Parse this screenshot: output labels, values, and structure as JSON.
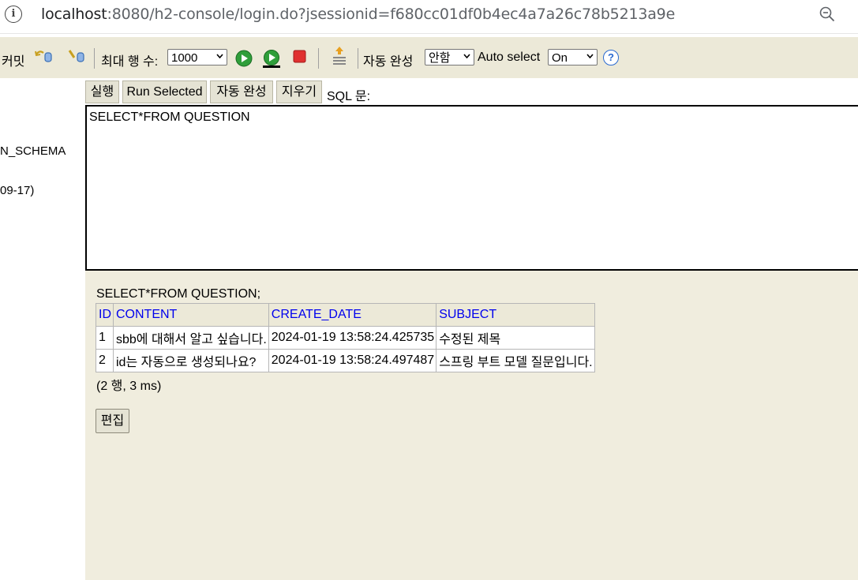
{
  "address_bar": {
    "host": "localhost",
    "path": ":8080/h2-console/login.do?jsessionid=f680cc01df0b4ec4a7a26c78b5213a9e"
  },
  "toolbar": {
    "commit_label": "커밋",
    "max_rows_label": "최대 행 수:",
    "max_rows_value": "1000",
    "autocomplete_label": "자동 완성",
    "autocomplete_value": "안함",
    "auto_select_label": "Auto select",
    "auto_select_value": "On",
    "help_glyph": "?"
  },
  "left_panel": {
    "items": [
      "N_SCHEMA",
      "09-17)"
    ]
  },
  "editor": {
    "buttons": [
      "실행",
      "Run Selected",
      "자동 완성",
      "지우기"
    ],
    "sql_label": "SQL 문:",
    "sql_text": "SELECT*FROM QUESTION"
  },
  "results": {
    "statement": "SELECT*FROM QUESTION;",
    "columns": [
      "ID",
      "CONTENT",
      "CREATE_DATE",
      "SUBJECT"
    ],
    "rows": [
      [
        "1",
        "sbb에 대해서 알고 싶습니다.",
        "2024-01-19 13:58:24.425735",
        "수정된 제목"
      ],
      [
        "2",
        "id는 자동으로 생성되나요?",
        "2024-01-19 13:58:24.497487",
        "스프링 부트 모델 질문입니다."
      ]
    ],
    "row_info": "(2 행, 3 ms)",
    "edit_label": "편집"
  }
}
